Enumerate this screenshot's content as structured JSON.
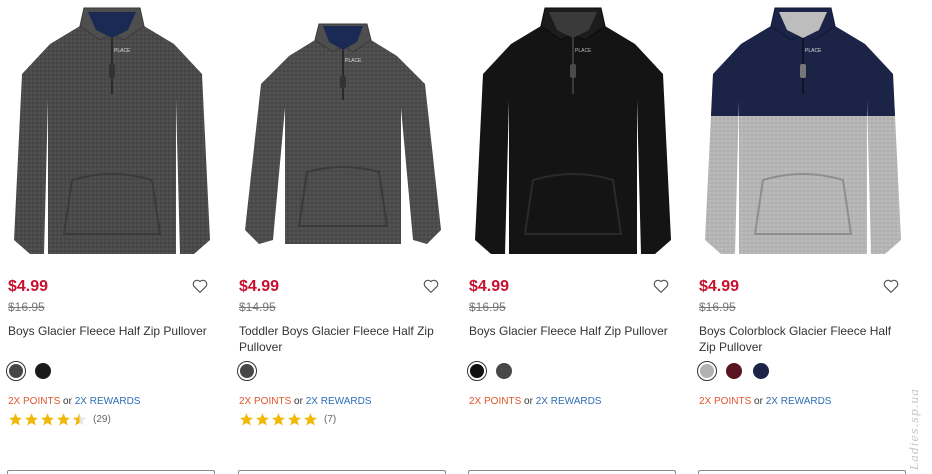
{
  "colors": {
    "price": "#c8102e",
    "points": "#e0562c",
    "rewards": "#2d6db5",
    "star": "#f2b807"
  },
  "products": [
    {
      "image": "charcoal-fleece-half-zip-pullover",
      "brand_tag": "PLACE",
      "price": "$4.99",
      "was_price": "$16.95",
      "name": "Boys Glacier Fleece Half Zip Pullover",
      "swatches": [
        {
          "color": "#474747",
          "selected": true
        },
        {
          "color": "#1a1a1a",
          "selected": false
        }
      ],
      "points_label": "2X POINTS",
      "or_label": "or",
      "rewards_label": "2X REWARDS",
      "rating": 4.5,
      "review_count": "(29)"
    },
    {
      "image": "toddler-charcoal-fleece-half-zip-pullover",
      "brand_tag": "PLACE",
      "price": "$4.99",
      "was_price": "$14.95",
      "name": "Toddler Boys Glacier Fleece Half Zip Pullover",
      "swatches": [
        {
          "color": "#474747",
          "selected": true
        }
      ],
      "points_label": "2X POINTS",
      "or_label": "or",
      "rewards_label": "2X REWARDS",
      "rating": 5,
      "review_count": "(7)"
    },
    {
      "image": "black-fleece-half-zip-pullover",
      "brand_tag": "PLACE",
      "price": "$4.99",
      "was_price": "$16.95",
      "name": "Boys Glacier Fleece Half Zip Pullover",
      "swatches": [
        {
          "color": "#111111",
          "selected": true
        },
        {
          "color": "#474747",
          "selected": false
        }
      ],
      "points_label": "2X POINTS",
      "or_label": "or",
      "rewards_label": "2X REWARDS"
    },
    {
      "image": "colorblock-fleece-half-zip-pullover",
      "brand_tag": "PLACE",
      "price": "$4.99",
      "was_price": "$16.95",
      "name": "Boys Colorblock Glacier Fleece Half Zip Pullover",
      "swatches": [
        {
          "color": "#b2b2b2",
          "selected": true
        },
        {
          "color": "#5a1420",
          "selected": false
        },
        {
          "color": "#1b2446",
          "selected": false
        }
      ],
      "points_label": "2X POINTS",
      "or_label": "or",
      "rewards_label": "2X REWARDS"
    }
  ],
  "watermark": "Ladies.sp.ua"
}
